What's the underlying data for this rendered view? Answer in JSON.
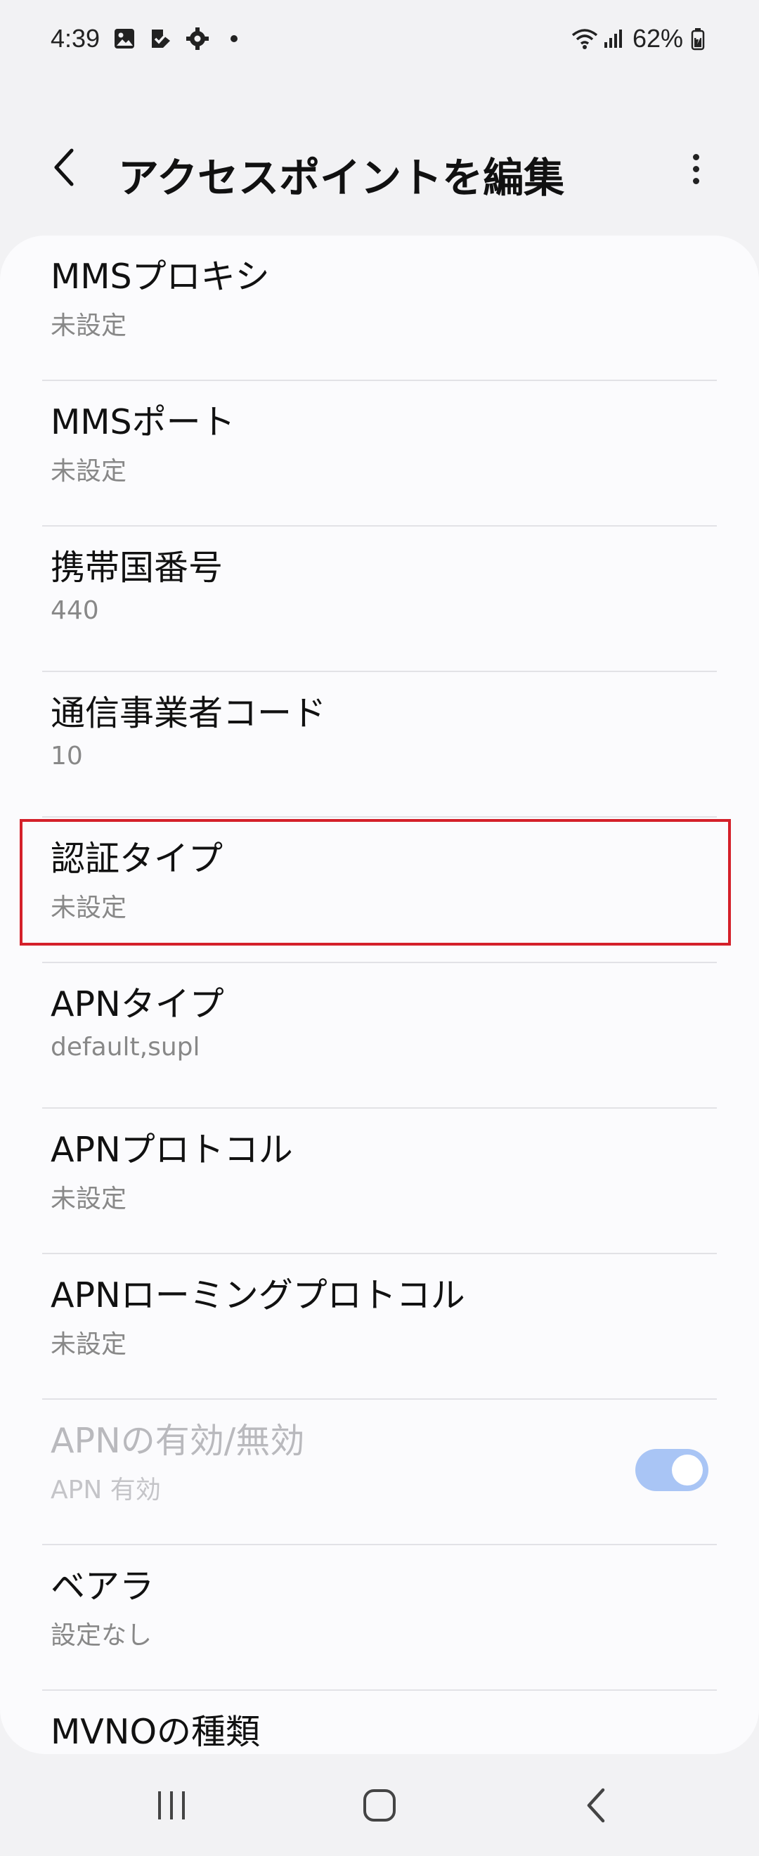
{
  "status_bar": {
    "time": "4:39",
    "battery": "62%",
    "icons": [
      "gallery-icon",
      "check-icon",
      "settings-gear-icon",
      "dot-icon",
      "wifi-icon",
      "signal-icon",
      "battery-icon"
    ]
  },
  "header": {
    "title": "アクセスポイントを編集",
    "back_icon": "chevron-left-icon",
    "more_icon": "more-vertical-icon"
  },
  "settings": {
    "items": [
      {
        "title": "MMSプロキシ",
        "value": "未設定"
      },
      {
        "title": "MMSポート",
        "value": "未設定"
      },
      {
        "title": "携帯国番号",
        "value": "440"
      },
      {
        "title": "通信事業者コード",
        "value": "10"
      },
      {
        "title": "認証タイプ",
        "value": "未設定"
      },
      {
        "title": "APNタイプ",
        "value": "default,supl"
      },
      {
        "title": "APNプロトコル",
        "value": "未設定"
      },
      {
        "title": "APNローミングプロトコル",
        "value": "未設定"
      },
      {
        "title": "APNの有効/無効",
        "value": "APN 有効",
        "toggle_on": true,
        "disabled": true
      },
      {
        "title": "ベアラ",
        "value": "設定なし"
      },
      {
        "title": "MVNOの種類",
        "value": ""
      }
    ]
  },
  "colors": {
    "highlight": "#d4202a",
    "toggle_track": "#a9c5f5"
  },
  "nav_bar": {
    "icons": [
      "recents-icon",
      "home-icon",
      "back-icon"
    ]
  }
}
